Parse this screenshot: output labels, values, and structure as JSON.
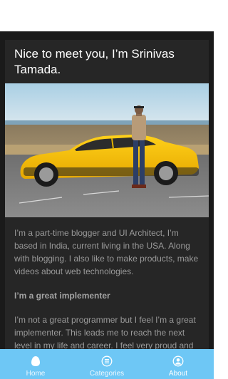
{
  "article": {
    "title": "Nice to meet you, I’m Srinivas Tamada.",
    "paragraph_1": "I’m a part-time blogger and UI Architect, I’m based in India, current living in the USA. Along with blogging. I also like to make products, make videos about web technologies.",
    "subheading": "I’m a great implementer",
    "paragraph_2": "I’m not a great programmer but I feel I’m a great implementer. This leads me to reach the next level in my life and career. I feel very proud and lucky"
  },
  "tabbar": {
    "items": [
      {
        "label": "Home",
        "icon": "home-egg-icon"
      },
      {
        "label": "Categories",
        "icon": "list-circle-icon"
      },
      {
        "label": "About",
        "icon": "person-circle-icon",
        "active": true
      }
    ]
  },
  "colors": {
    "tabbar_bg": "#6ec7f5",
    "card_bg": "#262626",
    "page_bg": "#1a1a1a",
    "car_yellow": "#f5c400"
  }
}
